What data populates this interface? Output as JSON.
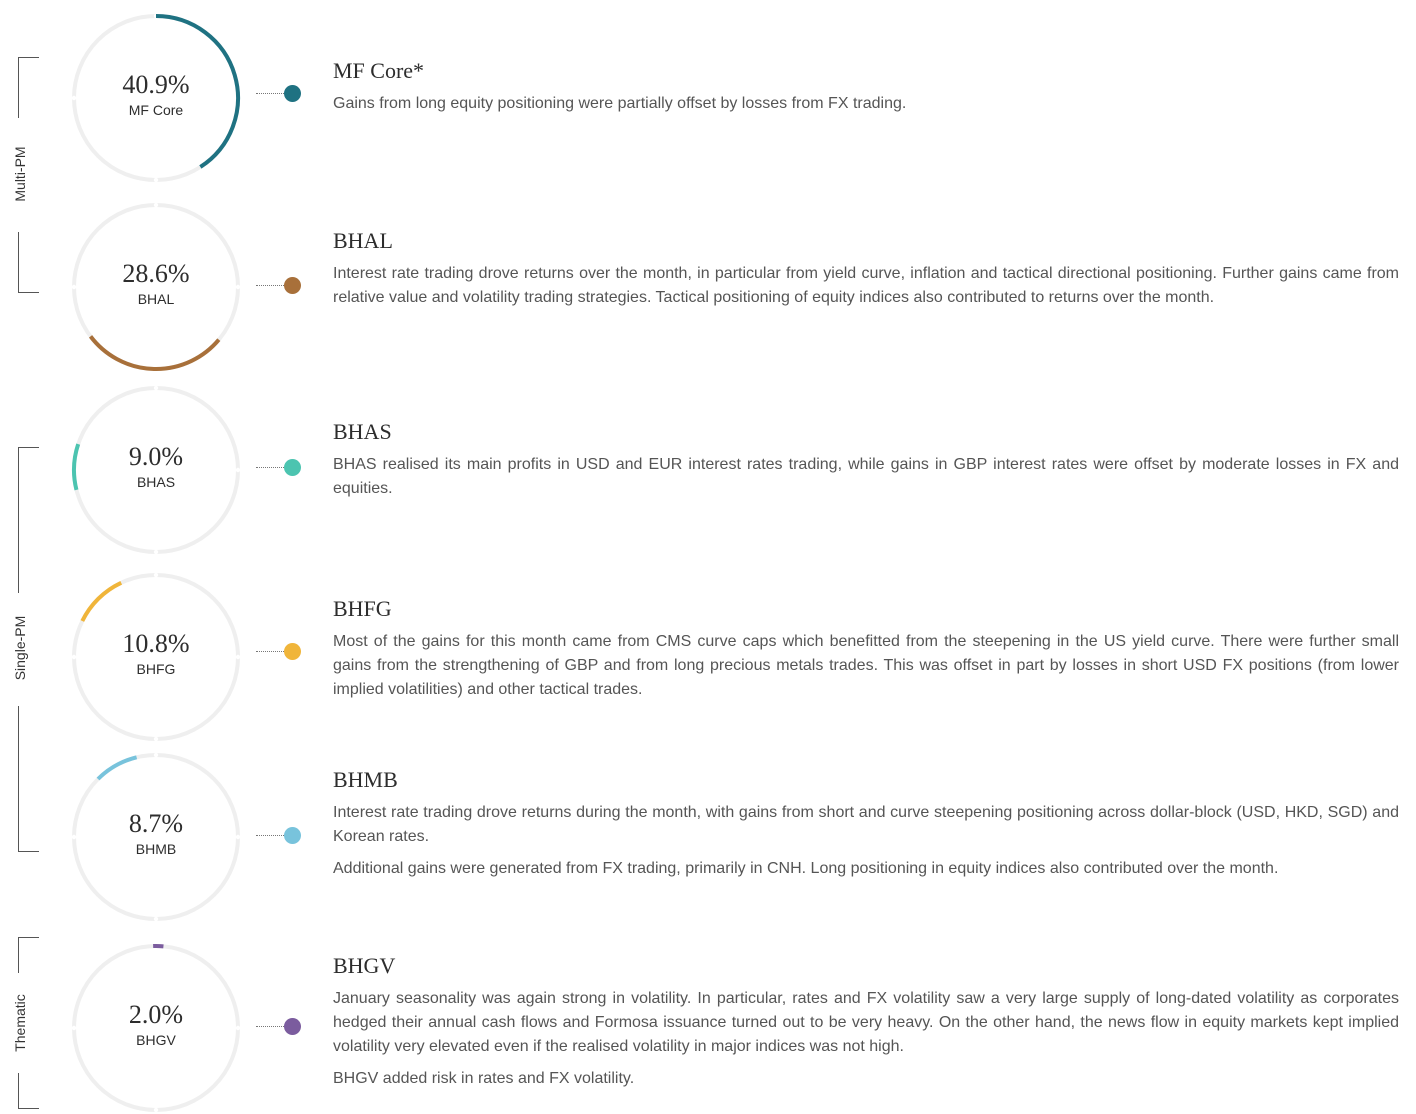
{
  "groups": [
    {
      "label": "Multi-PM"
    },
    {
      "label": "Single-PM"
    },
    {
      "label": "Thematic"
    }
  ],
  "chart_data": {
    "type": "donut-list",
    "ring_track_color": "#efefef",
    "items": [
      {
        "name": "MF Core",
        "title": "MF Core*",
        "value": 40.9,
        "value_label": "40.9%",
        "color": "#1f7282",
        "group": "Multi-PM",
        "paragraphs": [
          "Gains from long equity positioning were partially offset by losses from FX trading."
        ]
      },
      {
        "name": "BHAL",
        "title": "BHAL",
        "value": 28.6,
        "value_label": "28.6%",
        "color": "#a8703a",
        "group": "Multi-PM",
        "paragraphs": [
          "Interest rate trading drove returns over the month, in particular from yield curve, inflation and tactical directional positioning.  Further gains came from relative value and volatility trading strategies.  Tactical positioning of equity indices also contributed to returns over the month."
        ]
      },
      {
        "name": "BHAS",
        "title": "BHAS",
        "value": 9.0,
        "value_label": "9.0%",
        "color": "#4cc4b0",
        "group": "Single-PM",
        "paragraphs": [
          "BHAS realised its main profits in USD and EUR interest rates trading, while gains in GBP interest rates were offset by moderate losses in FX and equities."
        ]
      },
      {
        "name": "BHFG",
        "title": "BHFG",
        "value": 10.8,
        "value_label": "10.8%",
        "color": "#f0b53a",
        "group": "Single-PM",
        "paragraphs": [
          "Most of the gains for this month came from CMS curve caps which benefitted from the steepening in the US yield curve.  There were further small gains from the strengthening of GBP and from long precious metals trades.  This was offset in part by losses in short USD FX positions (from lower implied volatilities) and other tactical trades."
        ]
      },
      {
        "name": "BHMB",
        "title": "BHMB",
        "value": 8.7,
        "value_label": "8.7%",
        "color": "#78c3dc",
        "group": "Single-PM",
        "paragraphs": [
          "Interest rate trading drove returns during the month, with gains from short and curve steepening positioning across dollar-block (USD, HKD, SGD) and Korean rates.",
          "Additional gains were generated from FX trading, primarily in CNH.  Long positioning in equity indices also contributed over the month."
        ]
      },
      {
        "name": "BHGV",
        "title": "BHGV",
        "value": 2.0,
        "value_label": "2.0%",
        "color": "#7b5c9e",
        "group": "Thematic",
        "paragraphs": [
          "January seasonality was again strong in volatility.  In particular, rates and FX volatility saw a very large supply of long-dated volatility as corporates hedged their annual cash flows and Formosa issuance turned out to be very heavy.  On the other hand, the news flow in equity markets kept implied volatility very elevated even if the realised volatility in major indices was not high.",
          "BHGV added risk in rates and FX volatility."
        ]
      }
    ]
  }
}
